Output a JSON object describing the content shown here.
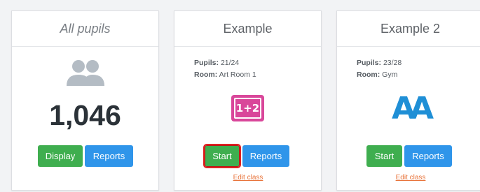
{
  "cards": [
    {
      "title": "All pupils",
      "count": "1,046",
      "buttons": {
        "display": "Display",
        "reports": "Reports"
      }
    },
    {
      "title": "Example",
      "pupils_label": "Pupils:",
      "pupils_value": "21/24",
      "room_label": "Room:",
      "room_value": "Art Room 1",
      "icon_text": "1+2",
      "buttons": {
        "start": "Start",
        "reports": "Reports"
      },
      "edit_link": "Edit class"
    },
    {
      "title": "Example 2",
      "pupils_label": "Pupils:",
      "pupils_value": "23/28",
      "room_label": "Room:",
      "room_value": "Gym",
      "icon_text": "AA",
      "buttons": {
        "start": "Start",
        "reports": "Reports"
      },
      "edit_link": "Edit class"
    }
  ],
  "colors": {
    "green": "#3fae4f",
    "blue": "#2f95ea",
    "link": "#e8743b",
    "math_icon": "#d9479a",
    "letters_icon": "#1f8fd6"
  },
  "icons": {
    "all_pupils": "users-icon",
    "example": "math-icon",
    "example2": "letters-icon"
  },
  "selected_button": "cards.1.start"
}
